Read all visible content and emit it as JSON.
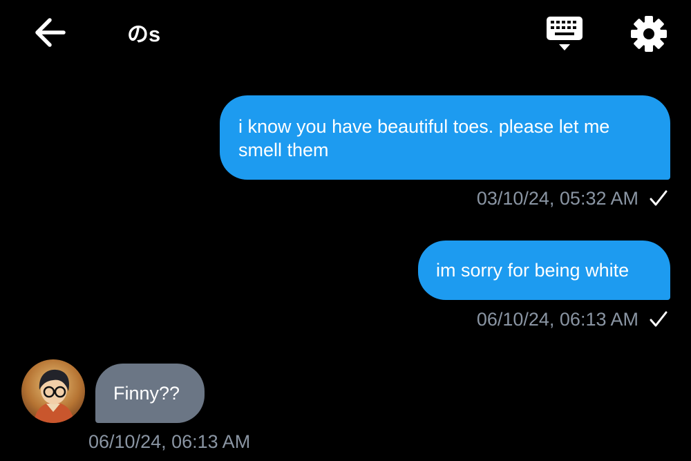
{
  "header": {
    "title": "のs",
    "back_icon": "arrow-left-icon",
    "keyboard_icon": "keyboard-icon",
    "settings_icon": "gear-icon"
  },
  "messages": [
    {
      "direction": "outgoing",
      "text": "i know you have beautiful toes. please let me smell them",
      "timestamp": "03/10/24, 05:32 AM",
      "status_icon": "check-icon"
    },
    {
      "direction": "outgoing",
      "text": "im sorry for being white",
      "timestamp": "06/10/24, 06:13 AM",
      "status_icon": "check-icon"
    },
    {
      "direction": "incoming",
      "text": "Finny??",
      "timestamp": "06/10/24, 06:13 AM",
      "avatar_icon": "avatar"
    }
  ],
  "colors": {
    "background": "#000000",
    "outgoing_bubble": "#1d9bf0",
    "incoming_bubble": "#6b7685",
    "timestamp_text": "#8a95a3",
    "icon": "#ffffff"
  }
}
